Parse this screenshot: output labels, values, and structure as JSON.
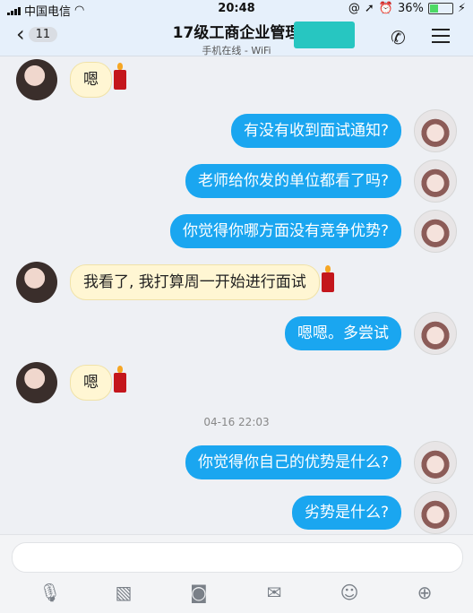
{
  "status_bar": {
    "carrier": "中国电信",
    "time": "20:48",
    "battery": "36%"
  },
  "header": {
    "back_count": "11",
    "title": "17级工商企业管理",
    "subtitle": "手机在线 - WiFi"
  },
  "messages": [
    {
      "side": "in",
      "text": "嗯",
      "emoji": "candle"
    },
    {
      "side": "out",
      "text": "有没有收到面试通知?"
    },
    {
      "side": "out",
      "text": "老师给你发的单位都看了吗?"
    },
    {
      "side": "out",
      "text": "你觉得你哪方面没有竞争优势?"
    },
    {
      "side": "in",
      "text": "我看了, 我打算周一开始进行面试",
      "emoji": "candle"
    },
    {
      "side": "out",
      "text": "嗯嗯。多尝试"
    },
    {
      "side": "in",
      "text": "嗯",
      "emoji": "candle"
    },
    {
      "side": "out",
      "text": "你觉得你自己的优势是什么?"
    },
    {
      "side": "out",
      "text": "劣势是什么?"
    }
  ],
  "timestamp": "04-16 22:03",
  "toolbar_icons": [
    "microphone-icon",
    "image-icon",
    "camera-icon",
    "red-packet-icon",
    "emoji-icon",
    "plus-icon"
  ],
  "colors": {
    "outgoing_bubble": "#1aa6f0",
    "incoming_bubble": "#fff6d3",
    "header_bg": "#e6f0fb"
  }
}
